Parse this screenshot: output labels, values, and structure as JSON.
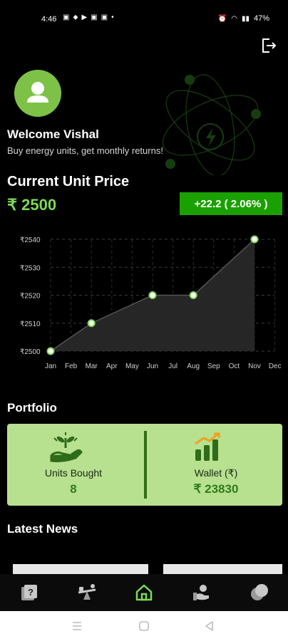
{
  "status_bar": {
    "time": "4:46",
    "battery": "47%",
    "icons": [
      "sim-icon",
      "location-icon",
      "youtube-icon",
      "linkedin-icon",
      "gallery-icon",
      "dot-icon",
      "alarm-icon",
      "wifi-icon",
      "signal-icon"
    ]
  },
  "header": {
    "welcome": "Welcome Vishal",
    "subtitle": "Buy energy units, get monthly returns!"
  },
  "price_section": {
    "title": "Current Unit Price",
    "price": "₹ 2500",
    "change": "+22.2 ( 2.06% )",
    "change_color": "#1aa000",
    "price_color": "#7ed957"
  },
  "chart_data": {
    "type": "area",
    "categories": [
      "Jan",
      "Feb",
      "Mar",
      "Apr",
      "May",
      "Jun",
      "Jul",
      "Aug",
      "Sep",
      "Oct",
      "Nov",
      "Dec"
    ],
    "points": [
      {
        "x": "Jan",
        "y": 2500
      },
      {
        "x": "Mar",
        "y": 2510
      },
      {
        "x": "Jun",
        "y": 2520
      },
      {
        "x": "Aug",
        "y": 2520
      },
      {
        "x": "Nov",
        "y": 2540
      }
    ],
    "y_ticks": [
      "₹2500",
      "₹2510",
      "₹2520",
      "₹2530",
      "₹2540"
    ],
    "ylim": [
      2500,
      2540
    ],
    "grid": true,
    "line_color": "#555555",
    "point_color": "#7ed957"
  },
  "portfolio": {
    "title": "Portfolio",
    "units_label": "Units Bought",
    "units_value": "8",
    "wallet_label": "Wallet (₹)",
    "wallet_value": "₹ 23830",
    "card_color": "#b7e08f"
  },
  "news": {
    "title": "Latest News"
  },
  "bottom_nav": {
    "items": [
      {
        "icon": "question-card-icon"
      },
      {
        "icon": "seesaw-icon"
      },
      {
        "icon": "home-icon",
        "active": true
      },
      {
        "icon": "hand-coin-icon"
      },
      {
        "icon": "coins-icon"
      }
    ],
    "active_color": "#7ed957"
  }
}
